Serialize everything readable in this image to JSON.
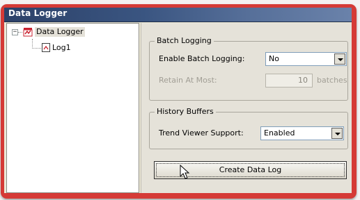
{
  "window": {
    "title": "Data Logger"
  },
  "tree": {
    "expander": "−",
    "root": {
      "label": "Data Logger",
      "icon": "data-logger-icon"
    },
    "children": [
      {
        "label": "Log1",
        "icon": "log-icon"
      }
    ]
  },
  "batch_logging": {
    "title": "Batch Logging",
    "enable_label": "Enable Batch Logging:",
    "enable_value": "No",
    "retain_label": "Retain At Most:",
    "retain_value": "10",
    "retain_unit": "batches"
  },
  "history_buffers": {
    "title": "History Buffers",
    "trend_label": "Trend Viewer Support:",
    "trend_value": "Enabled"
  },
  "create_button": {
    "label": "Create Data Log"
  },
  "colors": {
    "frame": "#d53a36",
    "titlebar": "#3a5581",
    "dialog": "#ece9d8"
  }
}
